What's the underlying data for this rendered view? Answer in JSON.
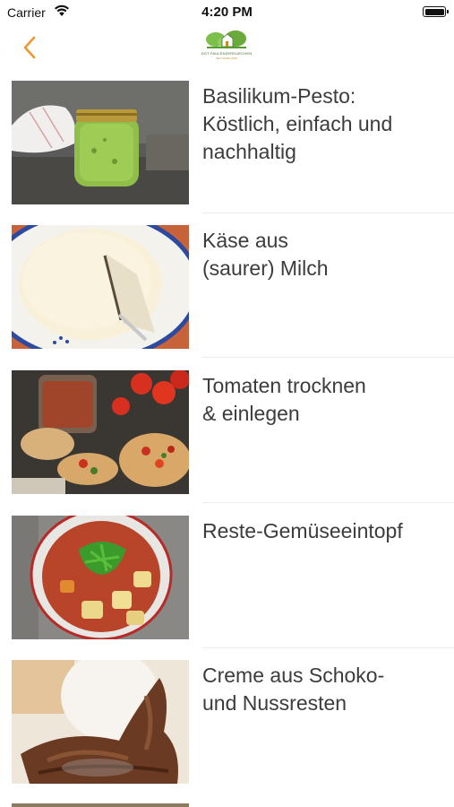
{
  "status_bar": {
    "carrier": "Carrier",
    "time": "4:20 PM"
  },
  "nav": {
    "logo_text": "DGT FAULENZERKUECHEN",
    "logo_subtext": "SEIT ANNO 2019"
  },
  "colors": {
    "accent": "#f0972e",
    "text": "#3c3c3c"
  },
  "recipes": [
    {
      "title_line1": "Basilikum-Pesto:",
      "title_line2": "Köstlich, einfach und",
      "title_line3": "nachhaltig",
      "image": "pesto-jar-photo"
    },
    {
      "title_line1": "Käse aus",
      "title_line2": "(saurer) Milch",
      "title_line3": "",
      "image": "cheese-plate-photo"
    },
    {
      "title_line1": "Tomaten trocknen",
      "title_line2": "& einlegen",
      "title_line3": "",
      "image": "dried-tomato-bruschetta-photo"
    },
    {
      "title_line1": "Reste-Gemüseeintopf",
      "title_line2": "",
      "title_line3": "",
      "image": "vegetable-stew-photo"
    },
    {
      "title_line1": "Creme aus Schoko-",
      "title_line2": "und Nussresten",
      "title_line3": "",
      "image": "chocolate-cream-photo"
    }
  ]
}
